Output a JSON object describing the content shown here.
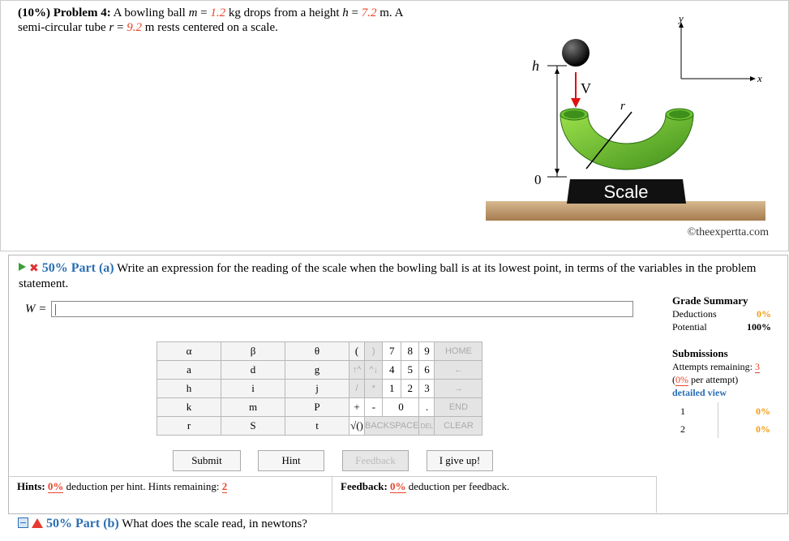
{
  "problem": {
    "number_label": "(10%) Problem 4:",
    "text_a": "A bowling ball",
    "m_var": "m",
    "m_val": "1.2",
    "m_unit": "kg drops from a height",
    "h_var": "h",
    "h_val": "7.2",
    "h_unit": "m. A",
    "text_b": "semi-circular tube",
    "r_var": "r",
    "r_val": "9.2",
    "text_c": "m rests centered on a scale.",
    "eq": "=",
    "copyright": "©theexpertta.com"
  },
  "figure": {
    "y_axis": "y",
    "x_axis": "x",
    "h_label": "h",
    "zero_label": "0",
    "v_label": "V",
    "r_label": "r",
    "scale_label": "Scale"
  },
  "part_a": {
    "pct": "50% Part (a)",
    "question": "Write an expression for the reading of the scale when the bowling ball is at its lowest point, in terms of the variables in the problem statement.",
    "answer_label": "W =",
    "answer_value": ""
  },
  "keypad": {
    "vars": [
      [
        "α",
        "β",
        "θ"
      ],
      [
        "a",
        "d",
        "g"
      ],
      [
        "h",
        "i",
        "j"
      ],
      [
        "k",
        "m",
        "P"
      ],
      [
        "r",
        "S",
        "t"
      ]
    ],
    "row1": [
      "(",
      ")",
      "7",
      "8",
      "9",
      "HOME"
    ],
    "row2": [
      "↑^",
      "^↓",
      "4",
      "5",
      "6",
      "←"
    ],
    "row3": [
      "/",
      "*",
      "1",
      "2",
      "3",
      "→"
    ],
    "row4": [
      "+",
      "-",
      "0",
      ".",
      "END"
    ],
    "row5": [
      "√()",
      "BACKSPACE",
      "DEL",
      "CLEAR"
    ]
  },
  "buttons": {
    "submit": "Submit",
    "hint": "Hint",
    "feedback": "Feedback",
    "give_up": "I give up!"
  },
  "hints": {
    "label": "Hints:",
    "pct": "0%",
    "text": "deduction per hint. Hints remaining:",
    "remaining": "2"
  },
  "feedback": {
    "label": "Feedback:",
    "pct": "0%",
    "text": "deduction per feedback."
  },
  "grade_summary": {
    "title": "Grade Summary",
    "deductions_label": "Deductions",
    "deductions": "0%",
    "potential_label": "Potential",
    "potential": "100%",
    "submissions_title": "Submissions",
    "attempts_label": "Attempts remaining:",
    "attempts": "3",
    "per_attempt_pct": "0%",
    "per_attempt_label": "per attempt)",
    "detailed_view": "detailed view",
    "submissions": [
      {
        "n": "1",
        "pct": "0%"
      },
      {
        "n": "2",
        "pct": "0%"
      }
    ]
  },
  "part_b": {
    "pct": "50% Part (b)",
    "question": "What does the scale read, in newtons?"
  }
}
